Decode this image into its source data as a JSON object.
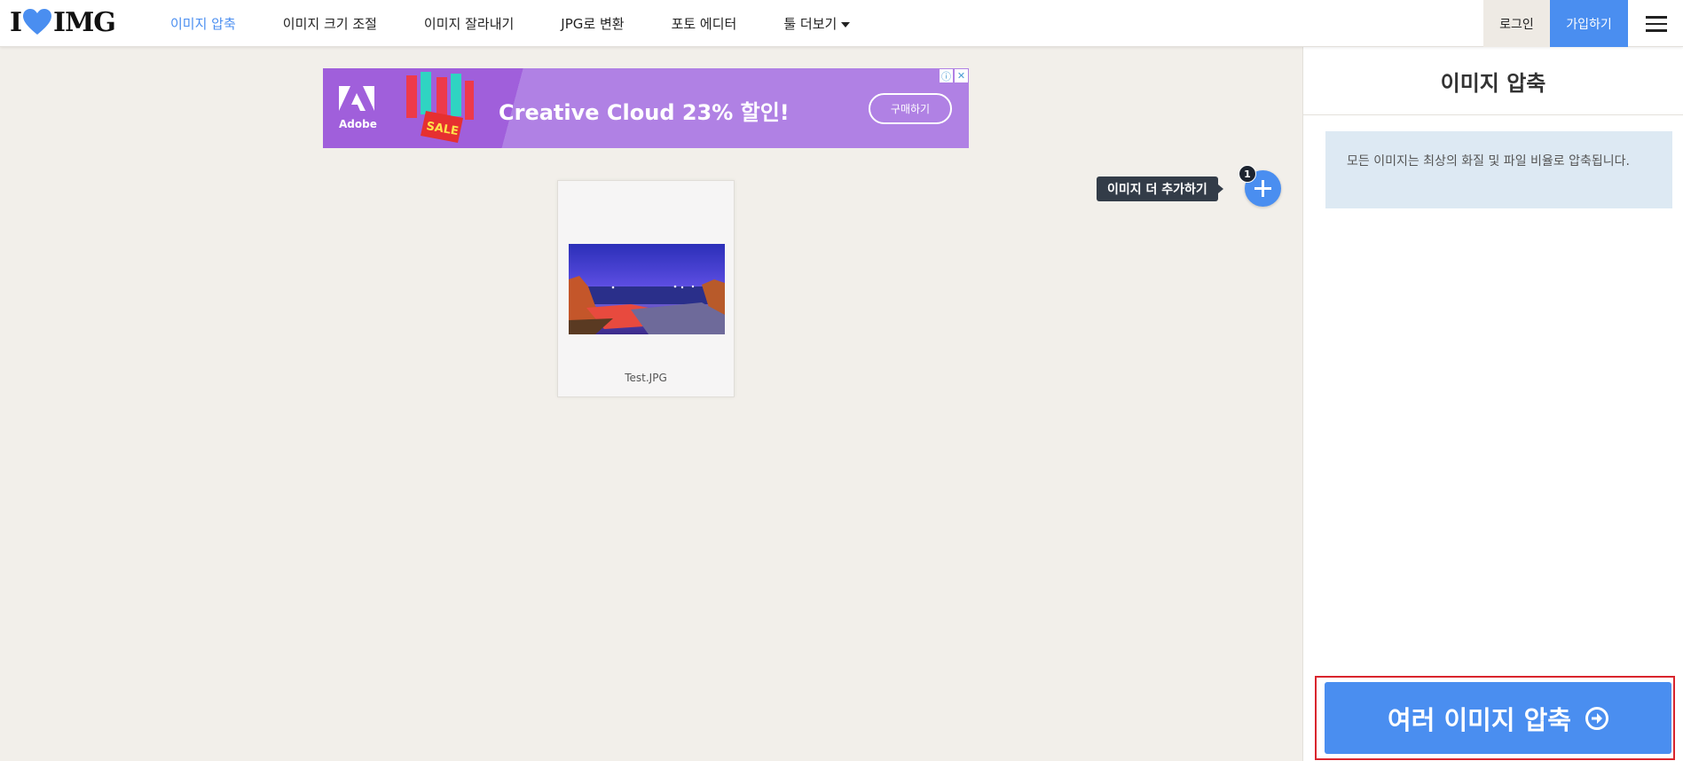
{
  "header": {
    "logo": {
      "left": "I",
      "right": "IMG"
    },
    "nav": [
      {
        "label": "이미지 압축",
        "active": true
      },
      {
        "label": "이미지 크기 조절",
        "active": false
      },
      {
        "label": "이미지 잘라내기",
        "active": false
      },
      {
        "label": "JPG로 변환",
        "active": false
      },
      {
        "label": "포토 에디터",
        "active": false
      },
      {
        "label": "툴 더보기",
        "active": false
      }
    ],
    "login": "로그인",
    "signup": "가입하기"
  },
  "ad": {
    "brand": "Adobe",
    "headline": "Creative Cloud 23% 할인!",
    "cta": "구매하기",
    "art_text": "SALE"
  },
  "workspace": {
    "file": {
      "name": "Test.JPG"
    },
    "add_more": {
      "tooltip": "이미지 더 추가하기",
      "count": "1"
    }
  },
  "sidebar": {
    "title": "이미지 압축",
    "info": "모든 이미지는 최상의 화질 및 파일 비율로 압축됩니다.",
    "action": "여러 이미지 압축"
  },
  "colors": {
    "accent": "#4a8ef0",
    "highlight_border": "#d9252d",
    "background": "#f2efea"
  }
}
